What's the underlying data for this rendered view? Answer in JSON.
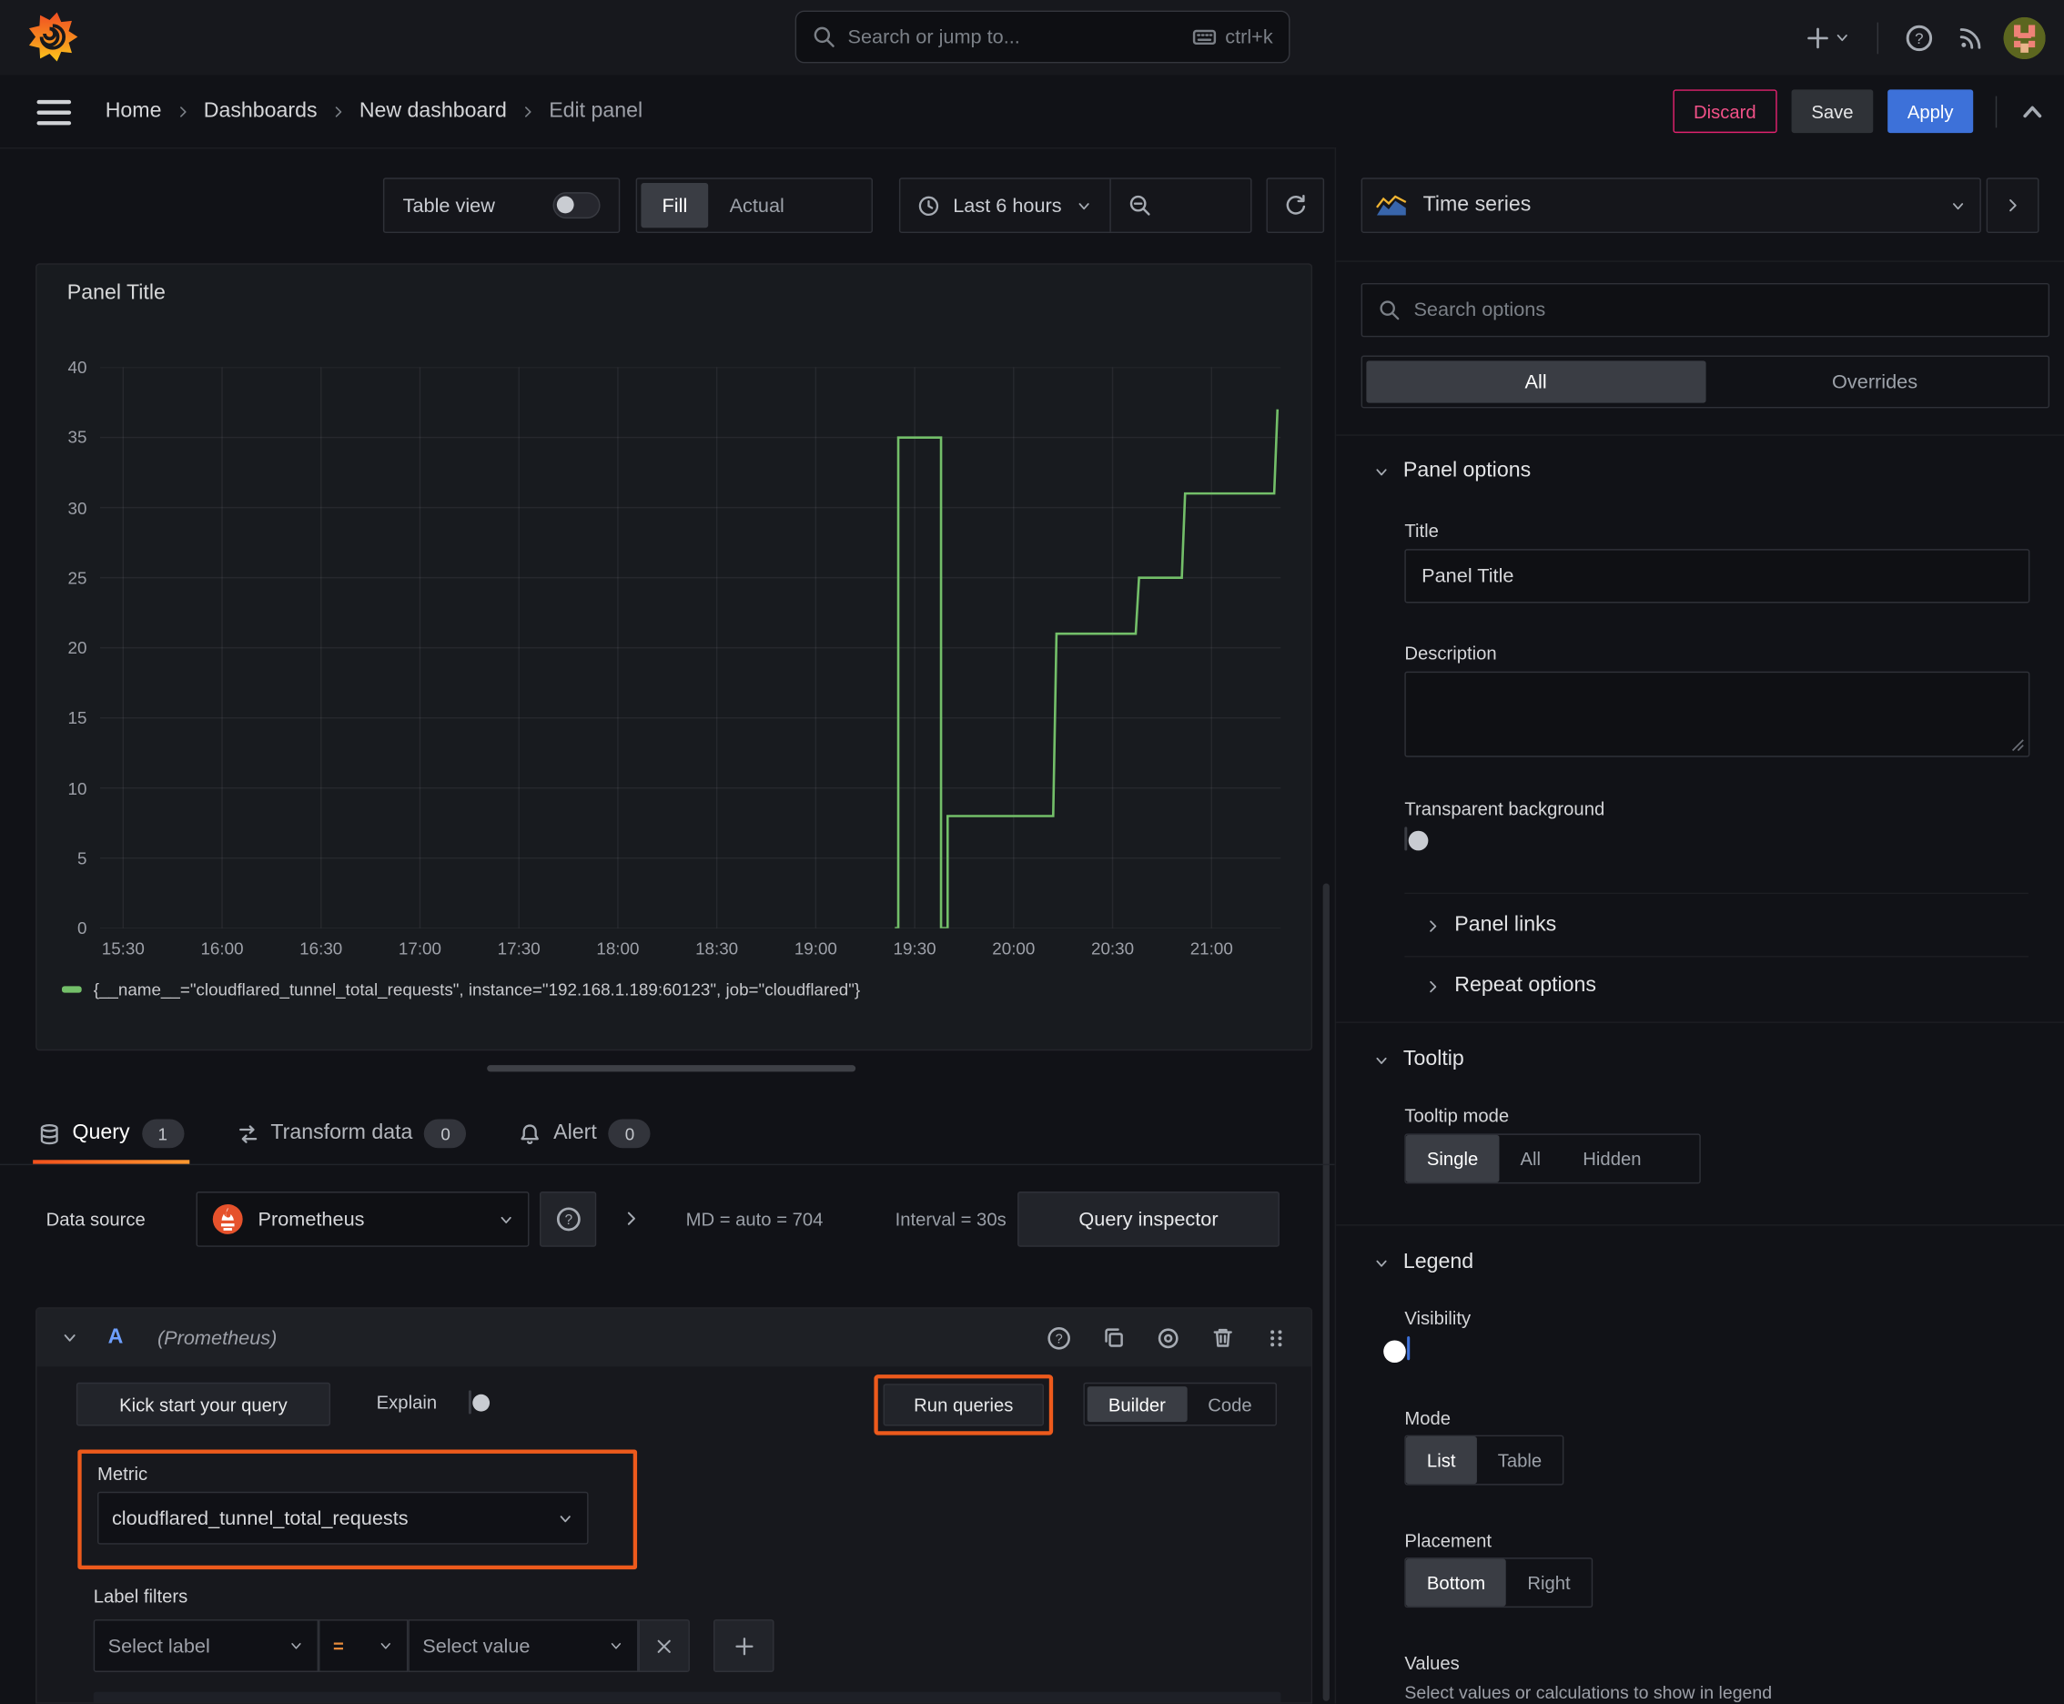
{
  "colors": {
    "accent_blue": "#3d71d9",
    "annotation_orange": "#ed5a1c",
    "series_green": "#73bf69",
    "danger_pink": "#e0226e",
    "brand_orange": "#f05a28"
  },
  "topbar": {
    "search_placeholder": "Search or jump to...",
    "shortcut": "ctrl+k"
  },
  "nav": {
    "breadcrumb": [
      "Home",
      "Dashboards",
      "New dashboard",
      "Edit panel"
    ],
    "discard": "Discard",
    "save": "Save",
    "apply": "Apply"
  },
  "controls": {
    "table_view": "Table view",
    "fill": "Fill",
    "actual": "Actual",
    "time_range": "Last 6 hours"
  },
  "panel": {
    "title": "Panel Title"
  },
  "chart_data": {
    "type": "line",
    "title": "Panel Title",
    "x_domain": [
      "15:23",
      "21:21"
    ],
    "y_domain": [
      0,
      40
    ],
    "x_ticks": [
      "15:30",
      "16:00",
      "16:30",
      "17:00",
      "17:30",
      "18:00",
      "18:30",
      "19:00",
      "19:30",
      "20:00",
      "20:30",
      "21:00"
    ],
    "y_ticks": [
      0,
      5,
      10,
      15,
      20,
      25,
      30,
      35,
      40
    ],
    "grid": true,
    "legend_position": "bottom",
    "series": [
      {
        "name": "{__name__=\"cloudflared_tunnel_total_requests\", instance=\"192.168.1.189:60123\", job=\"cloudflared\"}",
        "color": "#73bf69",
        "line_interpolation": "step",
        "points": [
          [
            "19:24",
            0
          ],
          [
            "19:25",
            0
          ],
          [
            "19:25",
            35
          ],
          [
            "19:38",
            35
          ],
          [
            "19:38",
            0
          ],
          [
            "19:40",
            0
          ],
          [
            "19:40",
            8
          ],
          [
            "20:12",
            8
          ],
          [
            "20:13",
            21
          ],
          [
            "20:37",
            21
          ],
          [
            "20:38",
            25
          ],
          [
            "20:51",
            25
          ],
          [
            "20:52",
            31
          ],
          [
            "21:19",
            31
          ],
          [
            "21:20",
            37
          ]
        ]
      }
    ]
  },
  "tabs": {
    "query": "Query",
    "query_count": "1",
    "transform": "Transform data",
    "transform_count": "0",
    "alert": "Alert",
    "alert_count": "0"
  },
  "datasource": {
    "label": "Data source",
    "name": "Prometheus",
    "stats_md": "MD = auto = 704",
    "stats_interval": "Interval = 30s",
    "inspector": "Query inspector"
  },
  "query": {
    "ref": "A",
    "ds_hint": "(Prometheus)",
    "kickstart": "Kick start your query",
    "explain": "Explain",
    "run": "Run queries",
    "builder": "Builder",
    "code": "Code",
    "metric_label": "Metric",
    "metric_value": "cloudflared_tunnel_total_requests",
    "label_filters": "Label filters",
    "select_label": "Select label",
    "operator": "=",
    "select_value": "Select value"
  },
  "sidebar": {
    "viz_name": "Time series",
    "search_placeholder": "Search options",
    "tab_all": "All",
    "tab_overrides": "Overrides",
    "panel_options": {
      "header": "Panel options",
      "title_label": "Title",
      "title_value": "Panel Title",
      "description_label": "Description",
      "transparent_label": "Transparent background"
    },
    "links": "Panel links",
    "repeat": "Repeat options",
    "tooltip": {
      "header": "Tooltip",
      "mode_label": "Tooltip mode",
      "options": [
        "Single",
        "All",
        "Hidden"
      ],
      "selected": "Single"
    },
    "legend": {
      "header": "Legend",
      "visibility_label": "Visibility",
      "mode_label": "Mode",
      "mode_options": [
        "List",
        "Table"
      ],
      "mode_selected": "List",
      "placement_label": "Placement",
      "placement_options": [
        "Bottom",
        "Right"
      ],
      "placement_selected": "Bottom",
      "values_label": "Values",
      "values_hint": "Select values or calculations to show in legend"
    }
  }
}
